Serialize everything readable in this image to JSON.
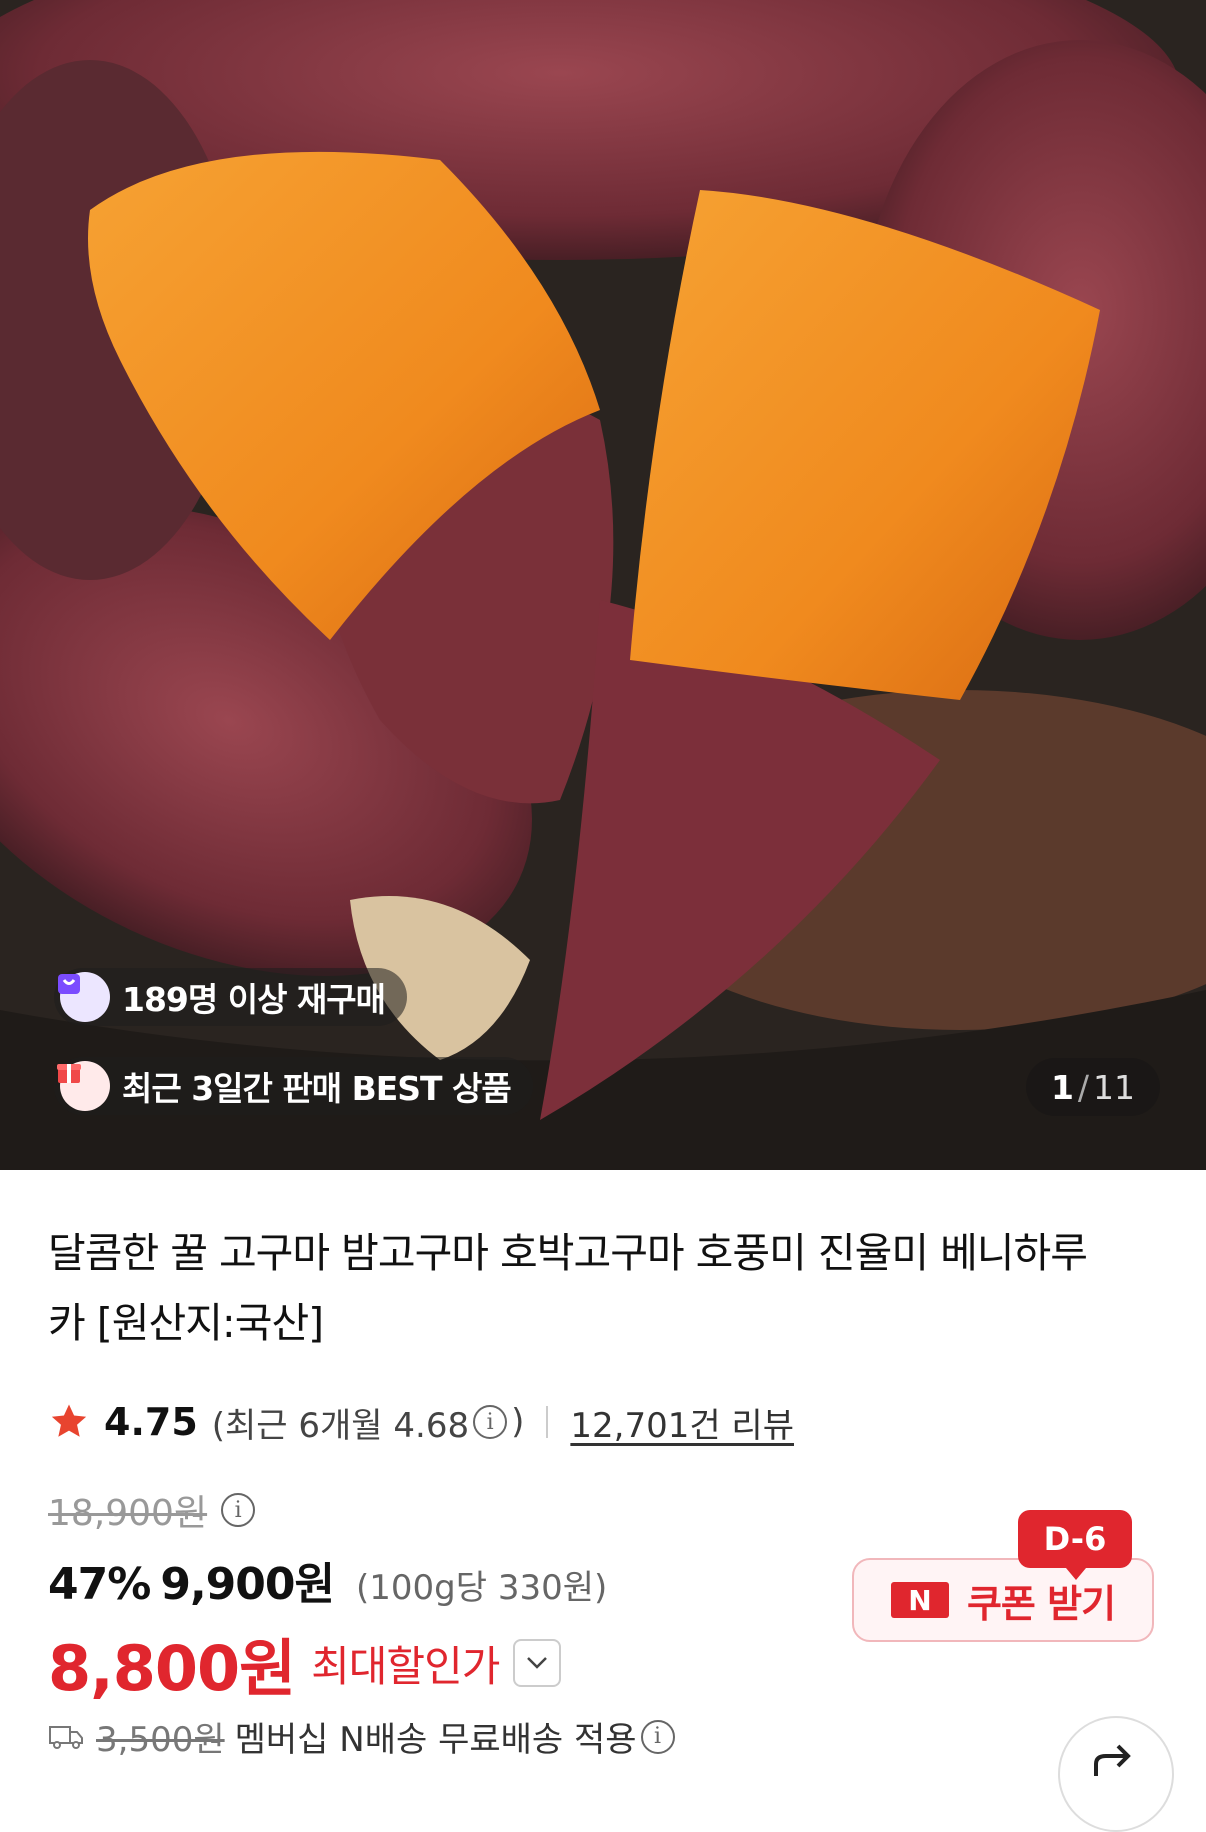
{
  "hero": {
    "badge_repurchase": "189명 이상 재구매",
    "badge_best": "최근 3일간 판매 BEST 상품",
    "image_index_current": "1",
    "image_index_separator": "/",
    "image_index_total": "11"
  },
  "product": {
    "title": "달콤한 꿀 고구마 밤고구마 호박고구마 호풍미 진율미 베니하루카 [원산지:국산]",
    "rating": {
      "score": "4.75",
      "recent_open": "(최근 6개월 4.68",
      "recent_close": ")",
      "info_icon": "i",
      "reviews": "12,701건 리뷰"
    },
    "price": {
      "original": "18,900원",
      "discount_percent": "47%",
      "sale_price": "9,900원",
      "unit_price": "(100g당 330원)",
      "final_price": "8,800원",
      "final_label": "최대할인가"
    },
    "coupon": {
      "label": "쿠폰 받기",
      "logo": "N",
      "dday": "D-6"
    },
    "shipping": {
      "fee": "3,500원",
      "text": "멤버십 N배송 무료배송 적용"
    }
  },
  "colors": {
    "accent": "#e0262e",
    "star": "#e8442f",
    "coupon_bg": "#fff4f5"
  }
}
